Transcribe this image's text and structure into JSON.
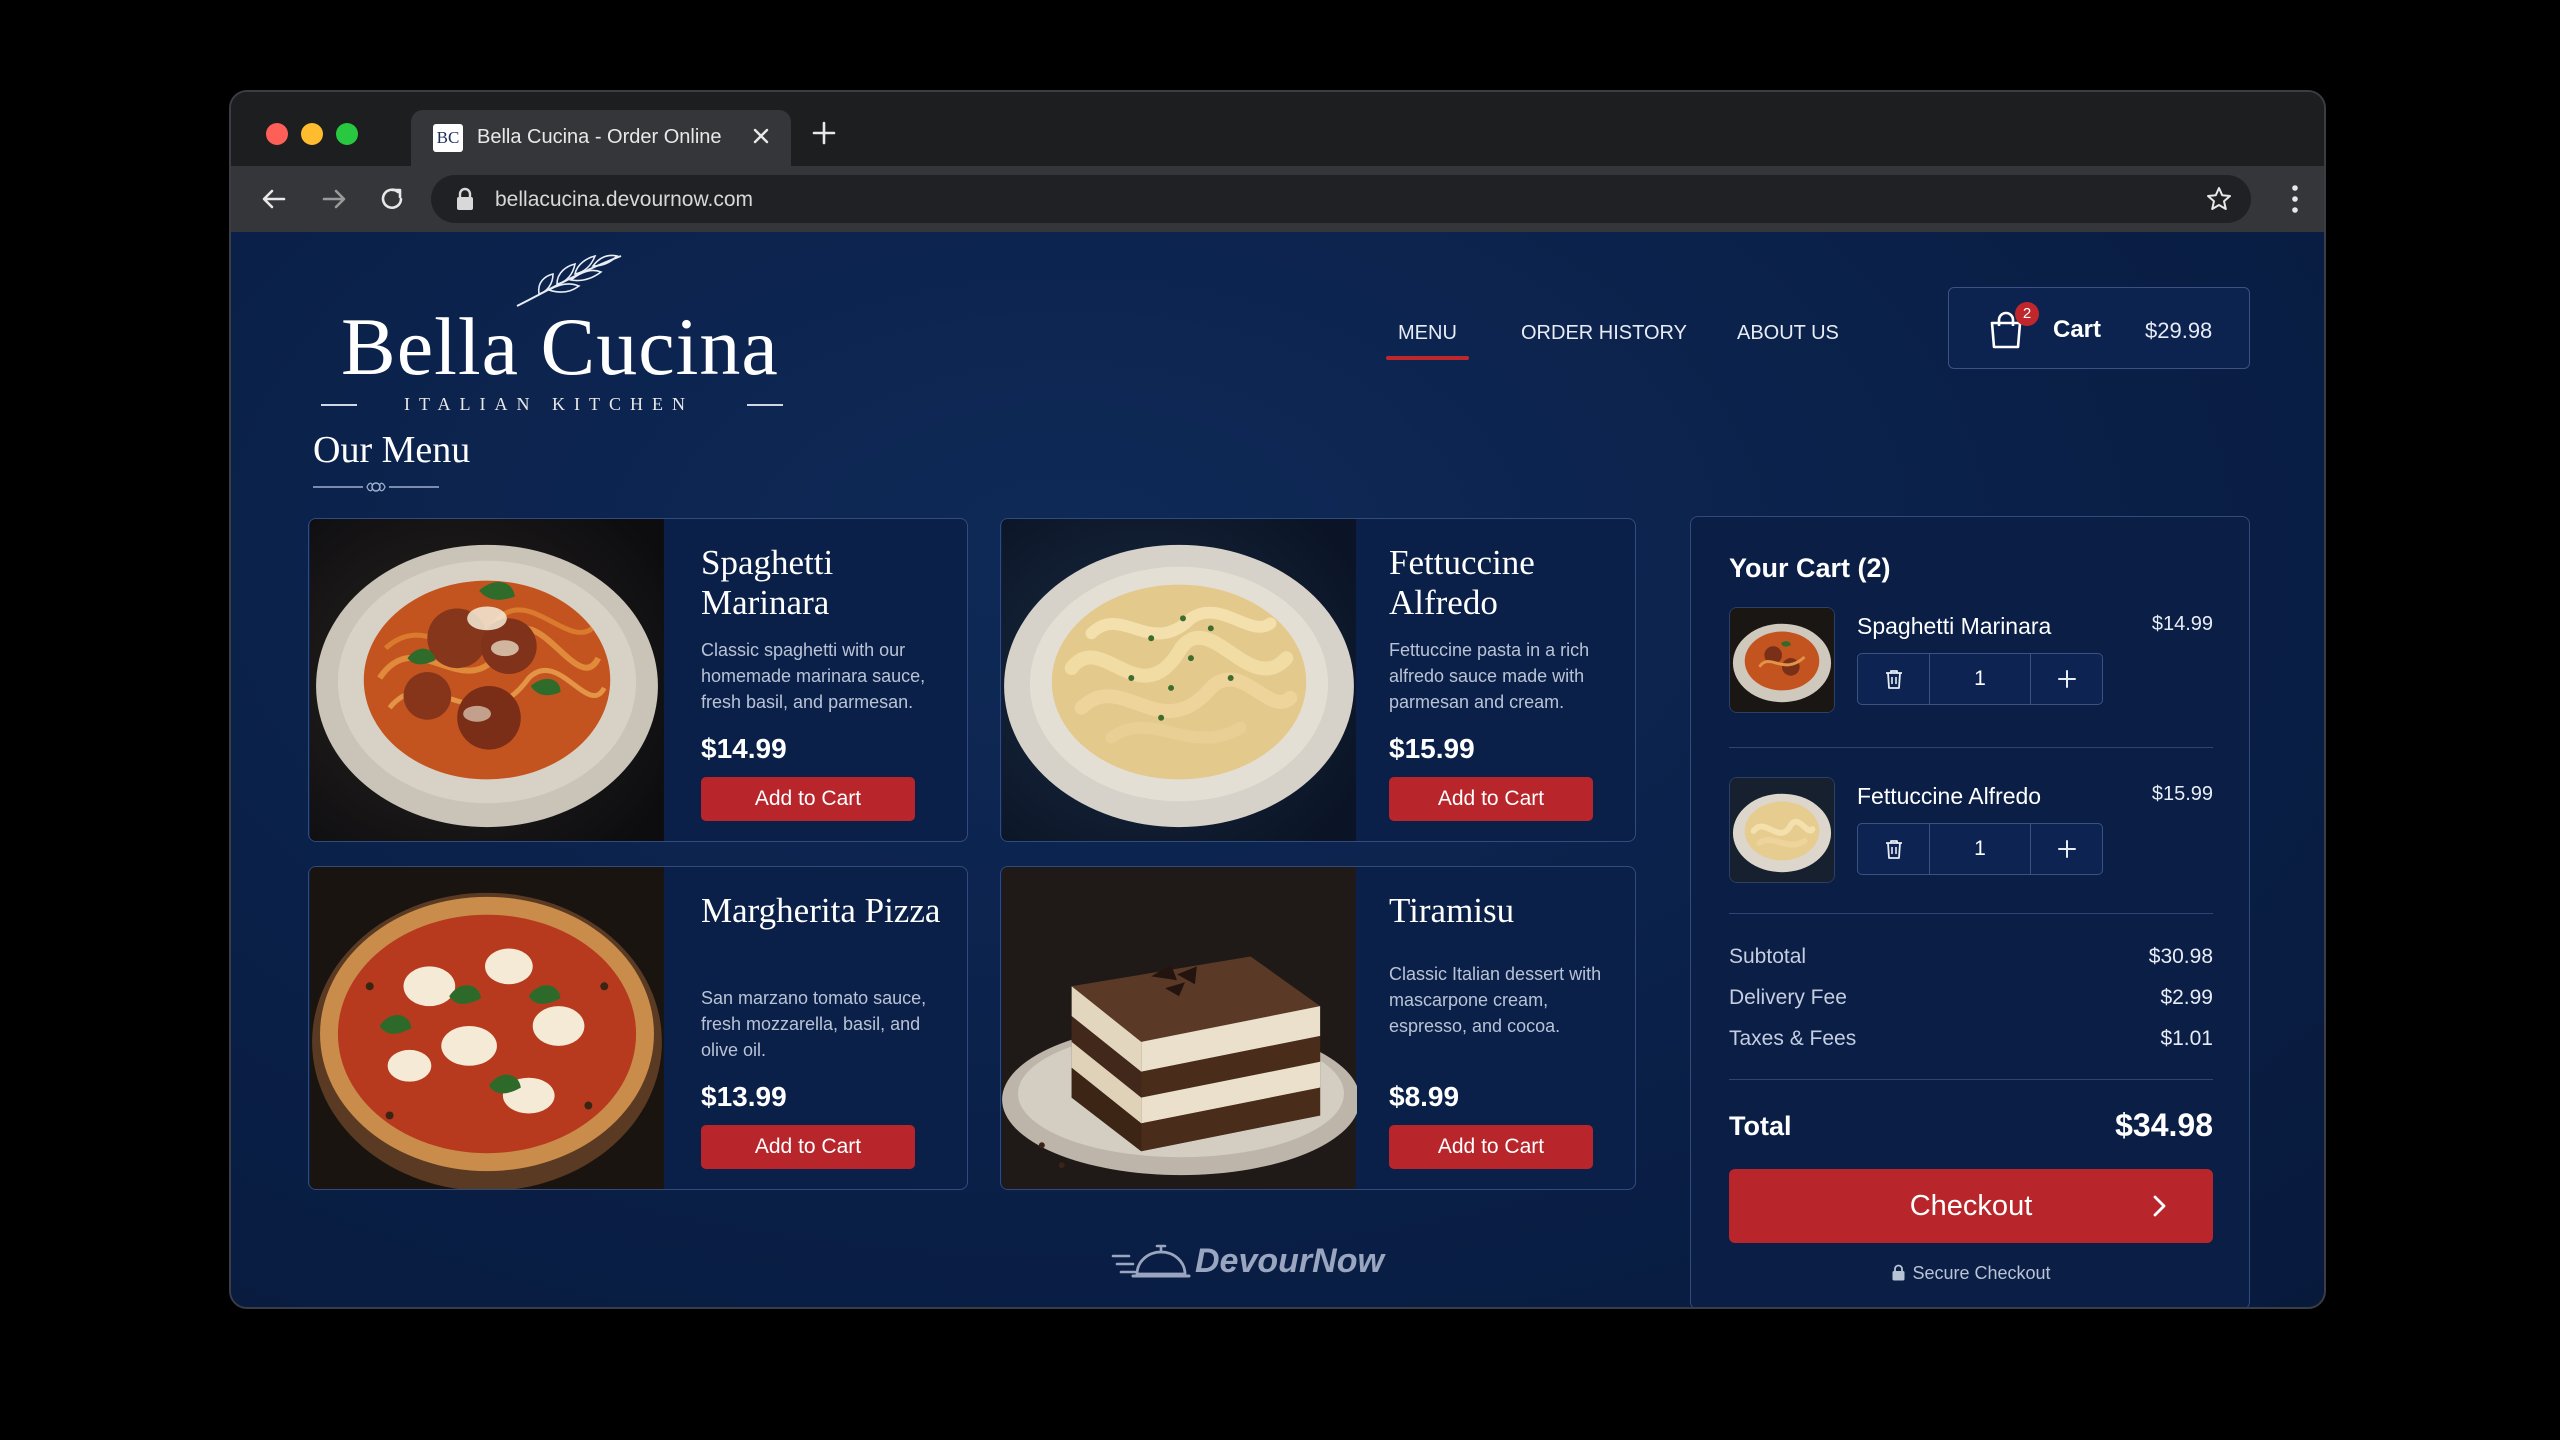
{
  "browser": {
    "tab_title": "Bella Cucina - Order Online",
    "favicon_text": "BC",
    "url": "bellacucina.devournow.com"
  },
  "brand": {
    "name": "Bella Cucina",
    "tagline": "ITALIAN KITCHEN"
  },
  "nav": {
    "items": [
      {
        "label": "MENU",
        "active": true
      },
      {
        "label": "ORDER HISTORY",
        "active": false
      },
      {
        "label": "ABOUT US",
        "active": false
      }
    ]
  },
  "header_cart": {
    "label": "Cart",
    "badge": "2",
    "total": "$29.98"
  },
  "menu": {
    "title": "Our Menu",
    "items": [
      {
        "name": "Spaghetti Marinara",
        "description": "Classic spaghetti with our homemade marinara sauce, fresh basil, and parmesan.",
        "price": "$14.99",
        "button": "Add to Cart"
      },
      {
        "name": "Fettuccine Alfredo",
        "description": "Fettuccine pasta in a rich alfredo sauce made with parmesan and cream.",
        "price": "$15.99",
        "button": "Add to Cart"
      },
      {
        "name": "Margherita Pizza",
        "description": "San marzano tomato sauce, fresh mozzarella, basil, and olive oil.",
        "price": "$13.99",
        "button": "Add to Cart"
      },
      {
        "name": "Tiramisu",
        "description": "Classic Italian dessert with mascarpone cream, espresso, and cocoa.",
        "price": "$8.99",
        "button": "Add to Cart"
      }
    ]
  },
  "cart": {
    "title": "Your Cart (2)",
    "items": [
      {
        "name": "Spaghetti Marinara",
        "price": "$14.99",
        "qty": "1"
      },
      {
        "name": "Fettuccine Alfredo",
        "price": "$15.99",
        "qty": "1"
      }
    ],
    "summary": [
      {
        "label": "Subtotal",
        "value": "$30.98"
      },
      {
        "label": "Delivery Fee",
        "value": "$2.99"
      },
      {
        "label": "Taxes & Fees",
        "value": "$1.01"
      }
    ],
    "total_label": "Total",
    "total_value": "$34.98",
    "checkout_label": "Checkout",
    "secure_label": "Secure Checkout"
  },
  "footer": {
    "powered_by": "DevourNow"
  },
  "colors": {
    "background": "#0a2048",
    "accent_red": "#b8262b",
    "card_border": "#324b7c"
  }
}
